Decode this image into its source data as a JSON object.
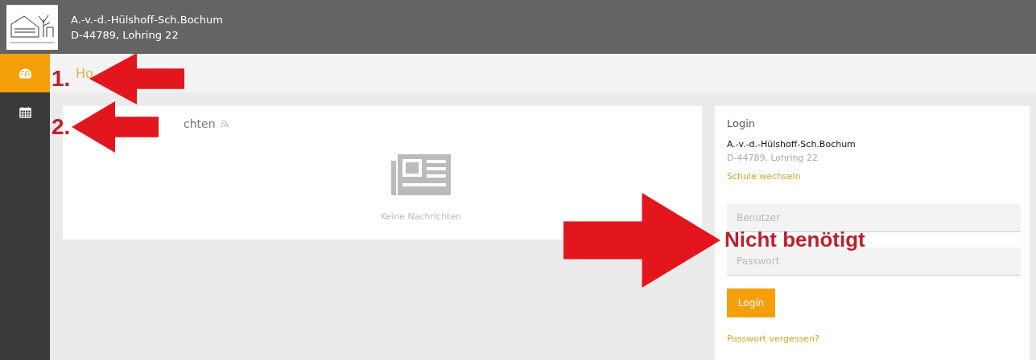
{
  "header": {
    "school_name": "A.-v.-d.-Hülshoff-Sch.Bochum",
    "address": "D-44789, Lohring 22"
  },
  "sidebar": {
    "items": [
      {
        "kind": "dashboard",
        "selected": true
      },
      {
        "kind": "calendar",
        "selected": false
      }
    ]
  },
  "breadcrumb": "Ho",
  "news": {
    "title": "chten",
    "empty_text": "Keine Nachrichten"
  },
  "login": {
    "title": "Login",
    "school_name": "A.-v.-d.-Hülshoff-Sch.Bochum",
    "address": "D-44789, Lohring 22",
    "change_link": "Schule wechseln",
    "fields": [
      {
        "placeholder": "Benutzer"
      },
      {
        "placeholder": "Passwort"
      }
    ],
    "button": "Login",
    "forgot_link": "Passwort vergessen?"
  },
  "annotations": [
    {
      "label": "1."
    },
    {
      "label": "2."
    },
    {
      "label": "Nicht benötigt"
    }
  ]
}
